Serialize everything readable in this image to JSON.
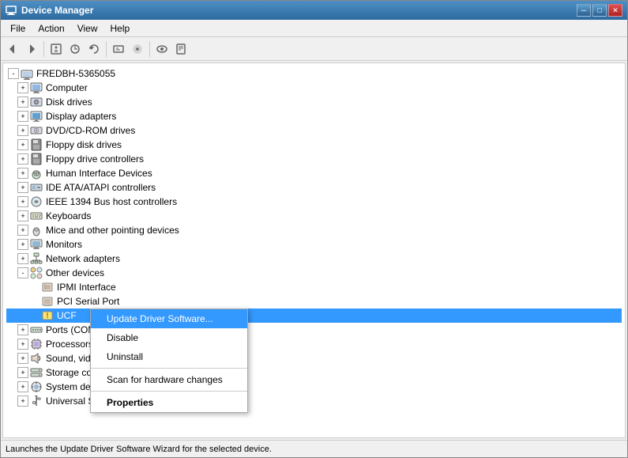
{
  "window": {
    "title": "Device Manager",
    "min_btn": "─",
    "max_btn": "□",
    "close_btn": "✕"
  },
  "menubar": {
    "items": [
      "File",
      "Action",
      "View",
      "Help"
    ]
  },
  "toolbar": {
    "buttons": [
      "◀",
      "▶",
      "⬆",
      "🔍",
      "🔍",
      "⟳",
      "🔧",
      "🖨",
      "⚡",
      "❌",
      "⬆"
    ]
  },
  "tree": {
    "root": "FREDBH-5365055",
    "items": [
      {
        "label": "Computer",
        "indent": 1,
        "expanded": true,
        "icon": "computer"
      },
      {
        "label": "Disk drives",
        "indent": 1,
        "expanded": false,
        "icon": "disk"
      },
      {
        "label": "Display adapters",
        "indent": 1,
        "expanded": false,
        "icon": "display"
      },
      {
        "label": "DVD/CD-ROM drives",
        "indent": 1,
        "expanded": false,
        "icon": "dvd"
      },
      {
        "label": "Floppy disk drives",
        "indent": 1,
        "expanded": false,
        "icon": "floppy"
      },
      {
        "label": "Floppy drive controllers",
        "indent": 1,
        "expanded": false,
        "icon": "floppy"
      },
      {
        "label": "Human Interface Devices",
        "indent": 1,
        "expanded": false,
        "icon": "hid"
      },
      {
        "label": "IDE ATA/ATAPI controllers",
        "indent": 1,
        "expanded": false,
        "icon": "ide"
      },
      {
        "label": "IEEE 1394 Bus host controllers",
        "indent": 1,
        "expanded": false,
        "icon": "ieee"
      },
      {
        "label": "Keyboards",
        "indent": 1,
        "expanded": false,
        "icon": "keyboard"
      },
      {
        "label": "Mice and other pointing devices",
        "indent": 1,
        "expanded": false,
        "icon": "mouse"
      },
      {
        "label": "Monitors",
        "indent": 1,
        "expanded": false,
        "icon": "monitor"
      },
      {
        "label": "Network adapters",
        "indent": 1,
        "expanded": false,
        "icon": "network"
      },
      {
        "label": "Other devices",
        "indent": 1,
        "expanded": true,
        "icon": "other"
      },
      {
        "label": "IPMI Interface",
        "indent": 2,
        "expanded": false,
        "icon": "device"
      },
      {
        "label": "PCI Serial Port",
        "indent": 2,
        "expanded": false,
        "icon": "pci"
      },
      {
        "label": "UCF",
        "indent": 2,
        "expanded": false,
        "icon": "usb-warn",
        "selected": true
      },
      {
        "label": "Ports (COM & LPT)",
        "indent": 1,
        "expanded": false,
        "icon": "ports"
      },
      {
        "label": "Processors",
        "indent": 1,
        "expanded": false,
        "icon": "processor"
      },
      {
        "label": "Sound, video and game controllers",
        "indent": 1,
        "expanded": false,
        "icon": "sound"
      },
      {
        "label": "Storage controllers",
        "indent": 1,
        "expanded": false,
        "icon": "storage"
      },
      {
        "label": "System devices",
        "indent": 1,
        "expanded": false,
        "icon": "system"
      },
      {
        "label": "Universal Serial Bus controllers",
        "indent": 1,
        "expanded": false,
        "icon": "universal"
      }
    ]
  },
  "context_menu": {
    "items": [
      {
        "label": "Update Driver Software...",
        "type": "normal",
        "active": true
      },
      {
        "label": "Disable",
        "type": "normal"
      },
      {
        "label": "Uninstall",
        "type": "normal"
      },
      {
        "separator": true
      },
      {
        "label": "Scan for hardware changes",
        "type": "normal"
      },
      {
        "separator": true
      },
      {
        "label": "Properties",
        "type": "bold"
      }
    ]
  },
  "status_bar": {
    "text": "Launches the Update Driver Software Wizard for the selected device."
  }
}
